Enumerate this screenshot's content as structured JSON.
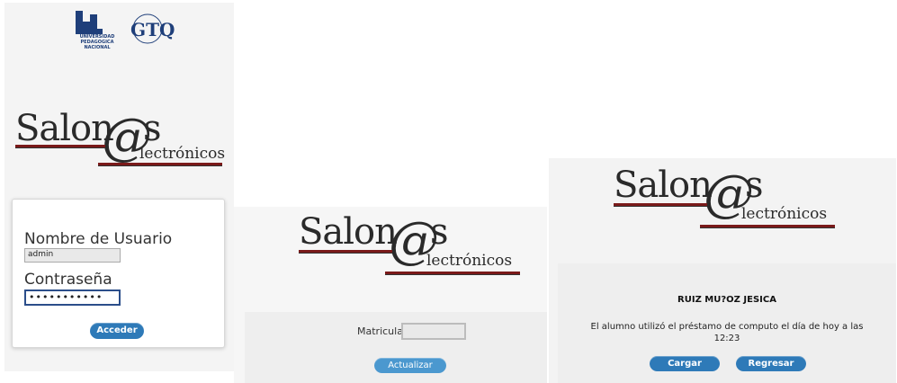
{
  "login": {
    "logo_upn_text": "UNIVERSIDAD PEDAGOGICA NACIONAL",
    "logo_gtq_text": "GTQ",
    "brand_main": "Salon",
    "brand_at": "@",
    "brand_s": "s",
    "brand_sub": "lectrónicos",
    "username_label": "Nombre de Usuario",
    "username_value": "admin",
    "password_label": "Contraseña",
    "password_value": "•••••••••••",
    "submit_label": "Acceder"
  },
  "search": {
    "brand_main": "Salon",
    "brand_at": "@",
    "brand_s": "s",
    "brand_sub": "lectrónicos",
    "matricula_label": "Matricula",
    "matricula_value": "",
    "update_label": "Actualizar"
  },
  "result": {
    "brand_main": "Salon",
    "brand_at": "@",
    "brand_s": "s",
    "brand_sub": "lectrónicos",
    "student_name": "RUIZ MU?OZ JESICA",
    "message_line1": "El alumno utilizó el préstamo de computo el día de hoy a las",
    "message_line2": "12:23",
    "load_label": "Cargar",
    "back_label": "Regresar"
  },
  "colors": {
    "button": "#2e7ab8",
    "brand_line": "#7a1a1a"
  }
}
